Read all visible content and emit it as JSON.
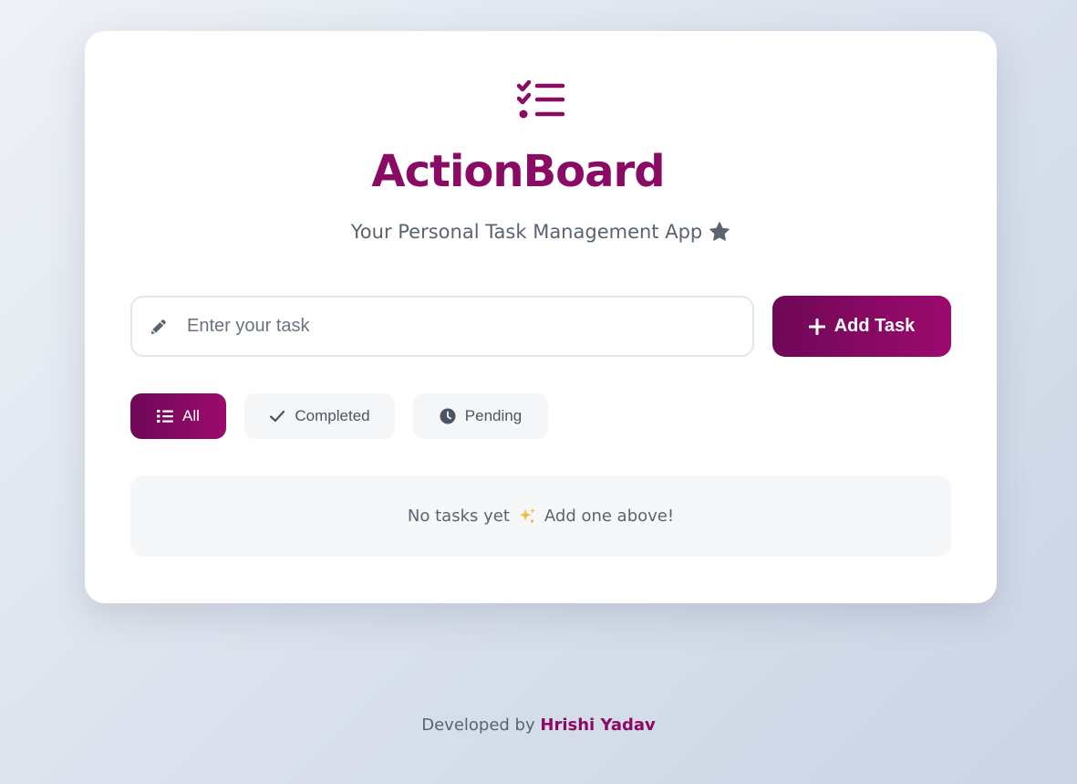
{
  "app": {
    "title": "ActionBoard",
    "subtitle": "Your Personal Task Management App",
    "logo_icon": "checklist-icon",
    "subtitle_icon": "star-icon"
  },
  "task_input": {
    "placeholder": "Enter your task",
    "value": "",
    "icon": "pencil-icon"
  },
  "add_button": {
    "label": "Add Task",
    "icon": "plus-icon"
  },
  "filters": [
    {
      "label": "All",
      "icon": "list-icon",
      "active": true
    },
    {
      "label": "Completed",
      "icon": "check-icon",
      "active": false
    },
    {
      "label": "Pending",
      "icon": "clock-icon",
      "active": false
    }
  ],
  "empty_state": {
    "text_before": "No tasks yet",
    "icon": "sparkles-icon",
    "text_after": "Add one above!"
  },
  "footer": {
    "prefix": "Developed by",
    "author": "Hrishi Yadav"
  },
  "colors": {
    "brand": "#8a0b63",
    "brand_dark": "#6e0857",
    "text_muted": "#5a6470"
  }
}
